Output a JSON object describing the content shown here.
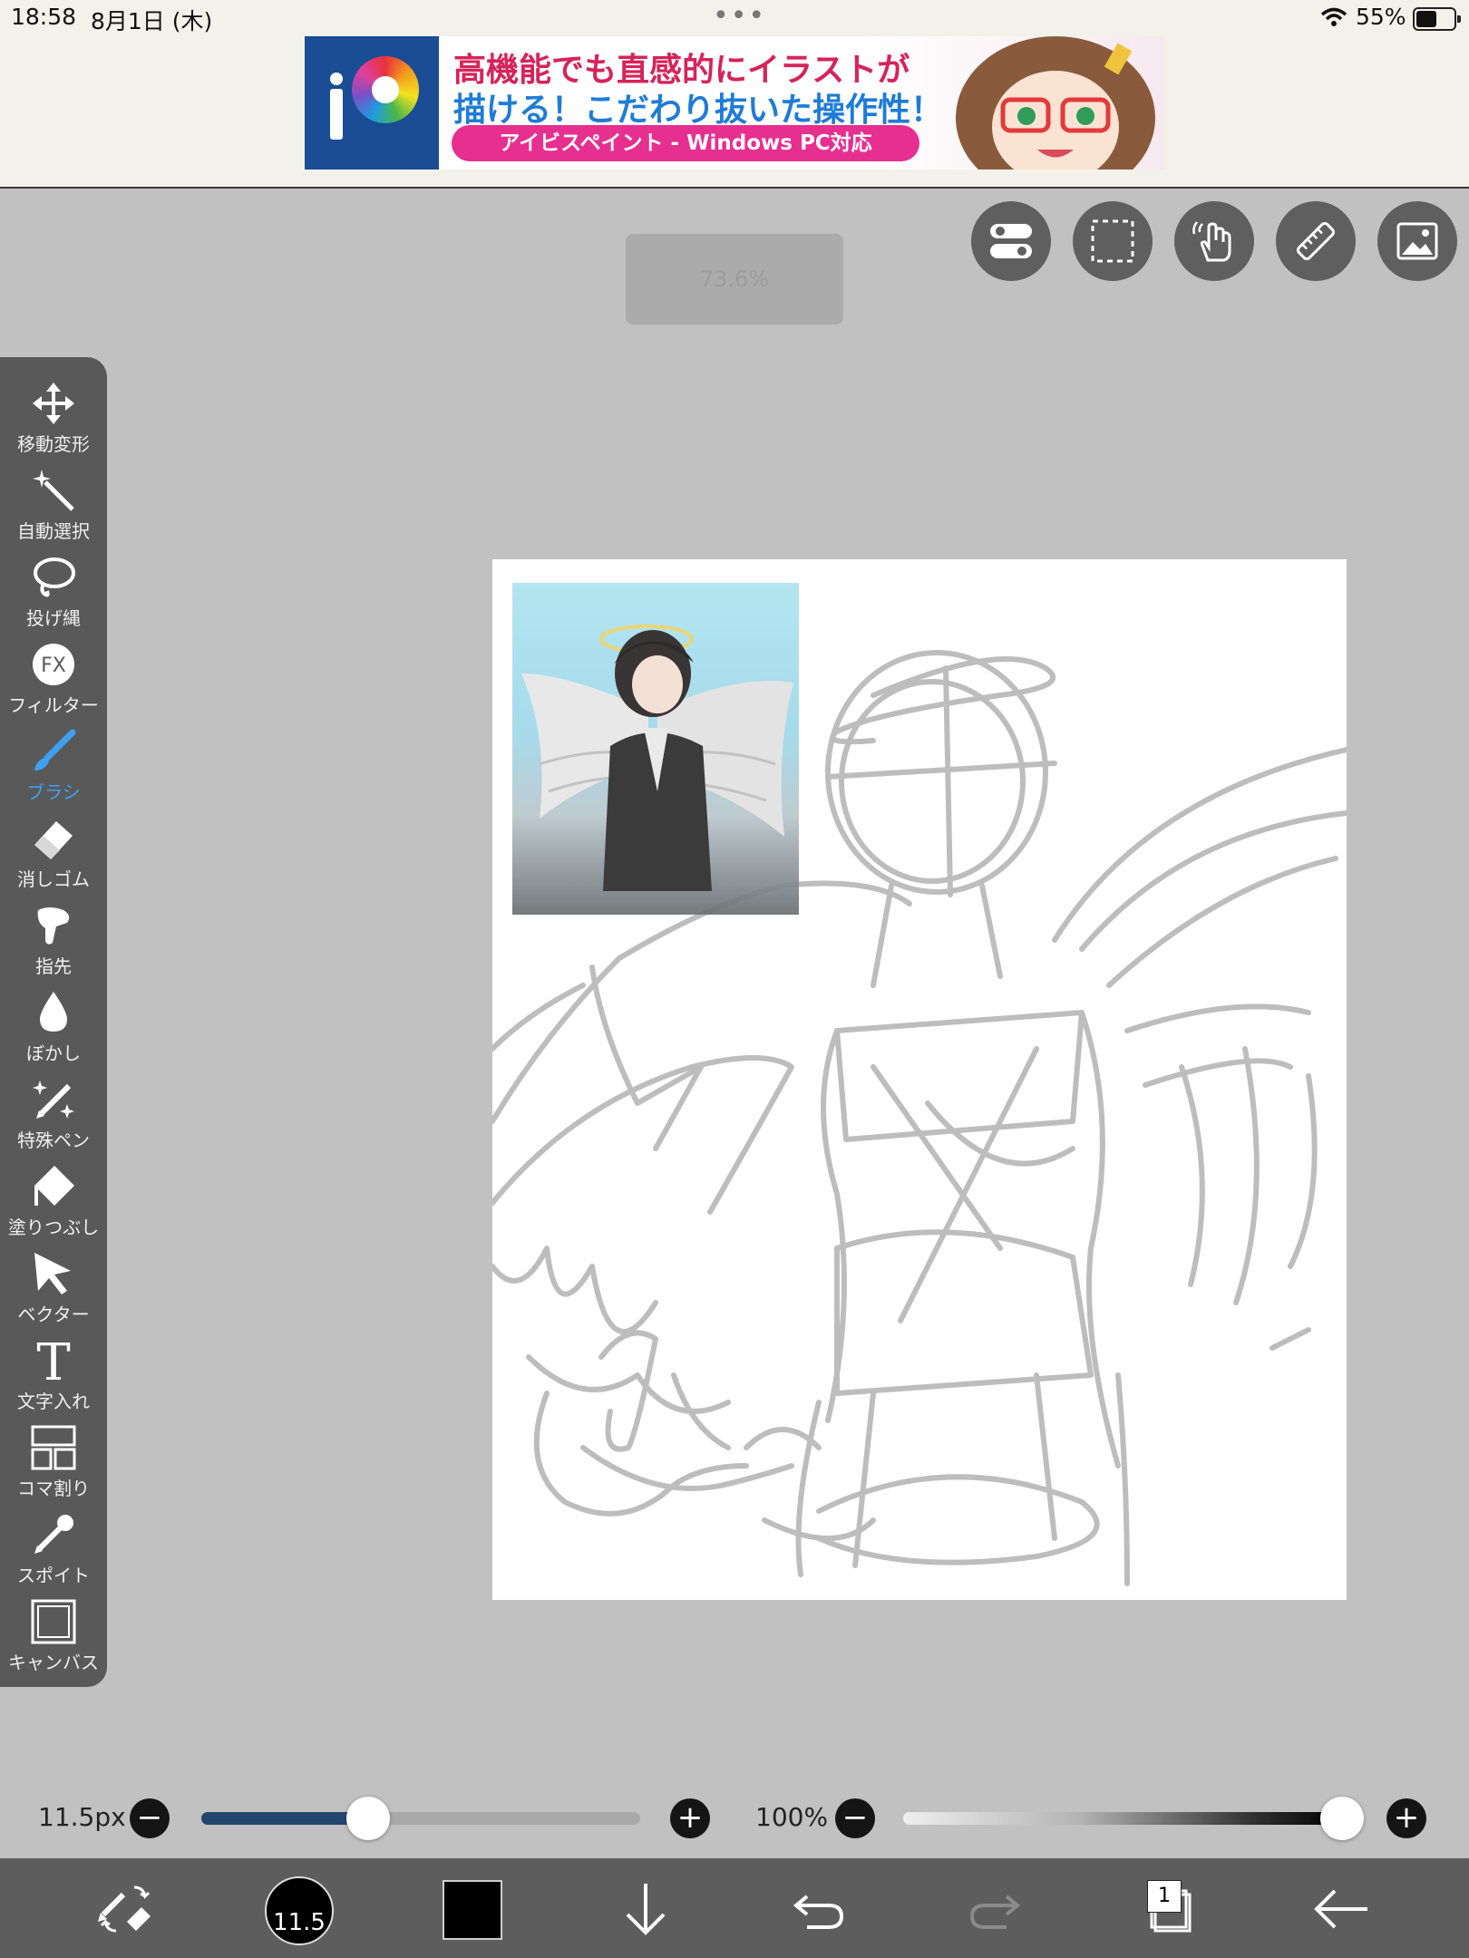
{
  "status": {
    "time": "18:58",
    "date": "8月1日 (木)",
    "battery": "55%",
    "battery_level": 0.55
  },
  "ad": {
    "line1": "高機能でも直感的にイラストが",
    "line2": "描ける！こだわり抜いた操作性！",
    "pill": "アイビスペイント - Windows PC対応"
  },
  "top_toolbar": {
    "zoom_toast": "73.6%",
    "buttons": [
      "settings-toggle-icon",
      "selection-icon",
      "hand-gesture-icon",
      "ruler-icon",
      "image-import-icon"
    ]
  },
  "tools": [
    {
      "label": "移動変形",
      "icon": "move-transform-icon"
    },
    {
      "label": "自動選択",
      "icon": "magic-wand-icon"
    },
    {
      "label": "投げ縄",
      "icon": "lasso-icon"
    },
    {
      "label": "フィルター",
      "icon": "fx-filter-icon"
    },
    {
      "label": "ブラシ",
      "icon": "brush-icon",
      "active": true
    },
    {
      "label": "消しゴム",
      "icon": "eraser-icon"
    },
    {
      "label": "指先",
      "icon": "smudge-finger-icon"
    },
    {
      "label": "ぼかし",
      "icon": "blur-drop-icon"
    },
    {
      "label": "特殊ペン",
      "icon": "special-pen-icon"
    },
    {
      "label": "塗りつぶし",
      "icon": "fill-bucket-icon"
    },
    {
      "label": "ベクター",
      "icon": "vector-arrow-icon"
    },
    {
      "label": "文字入れ",
      "icon": "text-icon"
    },
    {
      "label": "コマ割り",
      "icon": "frame-divider-icon"
    },
    {
      "label": "スポイト",
      "icon": "eyedropper-icon"
    },
    {
      "label": "キャンバス",
      "icon": "canvas-icon"
    }
  ],
  "brush": {
    "size_label": "11.5px",
    "size_fraction": 0.38,
    "opacity_label": "100%",
    "opacity_fraction": 1.0,
    "size_badge": "11.5"
  },
  "bottom": {
    "layer_count": "1",
    "color": "#000000"
  },
  "colors": {
    "accent": "#3ea0f0",
    "slider_fill": "#23466e",
    "palette_bg": "#595959",
    "workspace_bg": "#c1c1c1"
  }
}
